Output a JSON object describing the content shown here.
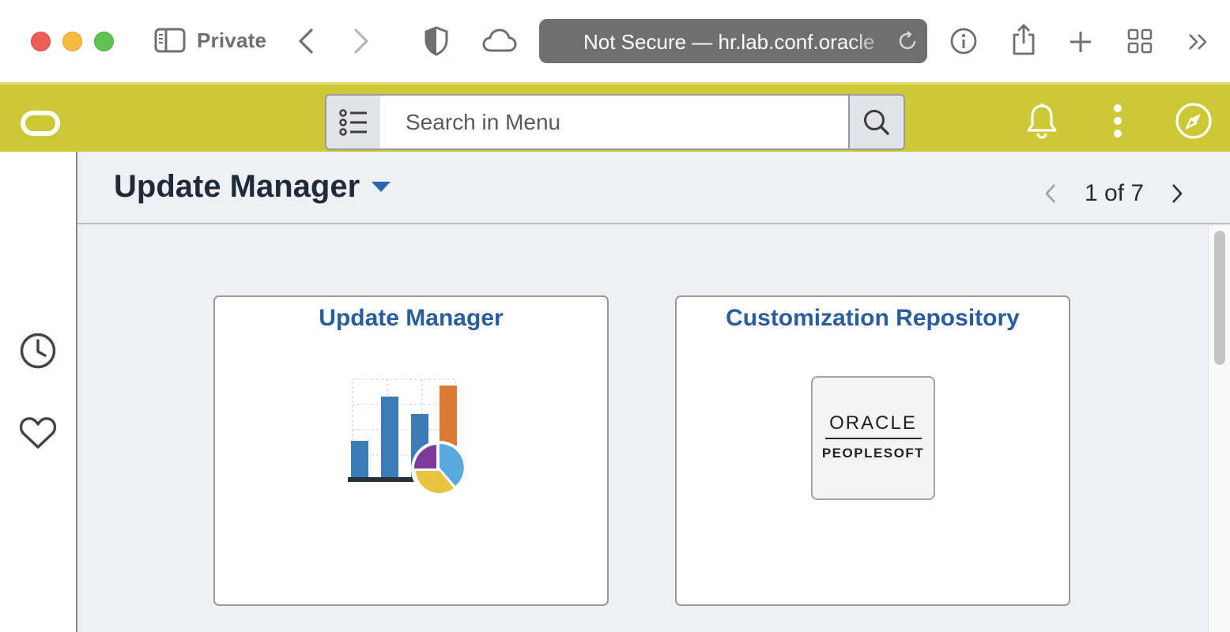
{
  "browser": {
    "private_label": "Private",
    "address": "Not Secure — hr.lab.conf.oracle"
  },
  "header": {
    "search_placeholder": "Search in Menu",
    "brand_color": "#cdc836"
  },
  "page": {
    "title": "Update Manager",
    "pager": "1 of 7"
  },
  "tiles": [
    {
      "title": "Update Manager",
      "icon": "chart-icon"
    },
    {
      "title": "Customization Repository",
      "icon": "oracle-peoplesoft-logo"
    }
  ],
  "peoplesoft_logo": {
    "oracle": "ORACLE",
    "peoplesoft": "PEOPLESOFT"
  },
  "left_rail": {
    "items": [
      {
        "icon": "recent-clock-icon"
      },
      {
        "icon": "favorites-heart-icon"
      }
    ]
  },
  "colors": {
    "link_blue": "#2a5d9e",
    "content_bg": "#eff0f4"
  }
}
